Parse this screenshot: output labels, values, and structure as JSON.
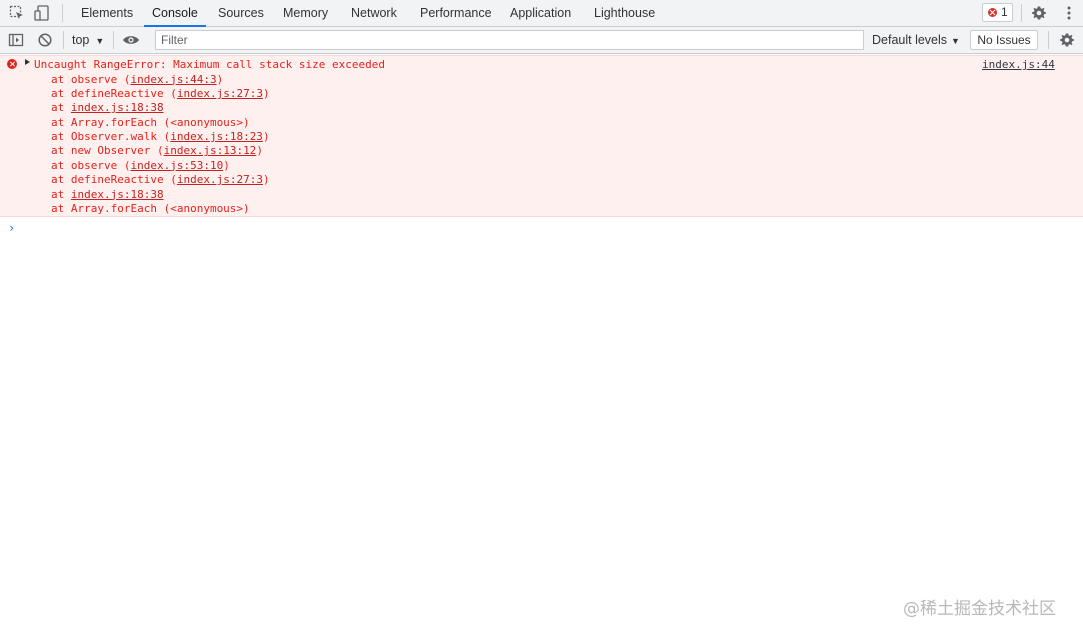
{
  "tabs": [
    {
      "label": "Elements"
    },
    {
      "label": "Console"
    },
    {
      "label": "Sources"
    },
    {
      "label": "Memory"
    },
    {
      "label": "Network"
    },
    {
      "label": "Performance"
    },
    {
      "label": "Application"
    },
    {
      "label": "Lighthouse"
    }
  ],
  "active_tab": "Console",
  "error_count": "1",
  "toolbar": {
    "context": "top",
    "filter_placeholder": "Filter",
    "levels_label": "Default levels",
    "issues_label": "No Issues"
  },
  "console": {
    "error_message": "Uncaught RangeError: Maximum call stack size exceeded",
    "source": "index.js:44",
    "stack": [
      {
        "pre": "at observe (",
        "loc": "index.js:44:3",
        "post": ")"
      },
      {
        "pre": "at defineReactive (",
        "loc": "index.js:27:3",
        "post": ")"
      },
      {
        "pre": "at ",
        "loc": "index.js:18:38",
        "post": ""
      },
      {
        "pre": "at Array.forEach (<anonymous>)",
        "loc": "",
        "post": ""
      },
      {
        "pre": "at Observer.walk (",
        "loc": "index.js:18:23",
        "post": ")"
      },
      {
        "pre": "at new Observer (",
        "loc": "index.js:13:12",
        "post": ")"
      },
      {
        "pre": "at observe (",
        "loc": "index.js:53:10",
        "post": ")"
      },
      {
        "pre": "at defineReactive (",
        "loc": "index.js:27:3",
        "post": ")"
      },
      {
        "pre": "at ",
        "loc": "index.js:18:38",
        "post": ""
      },
      {
        "pre": "at Array.forEach (<anonymous>)",
        "loc": "",
        "post": ""
      }
    ],
    "prompt_symbol": "›"
  },
  "watermark": "@稀土掘金技术社区",
  "colors": {
    "error_text": "#e2231a",
    "error_background": "#fff0f0",
    "accent": "#1a73e8"
  }
}
